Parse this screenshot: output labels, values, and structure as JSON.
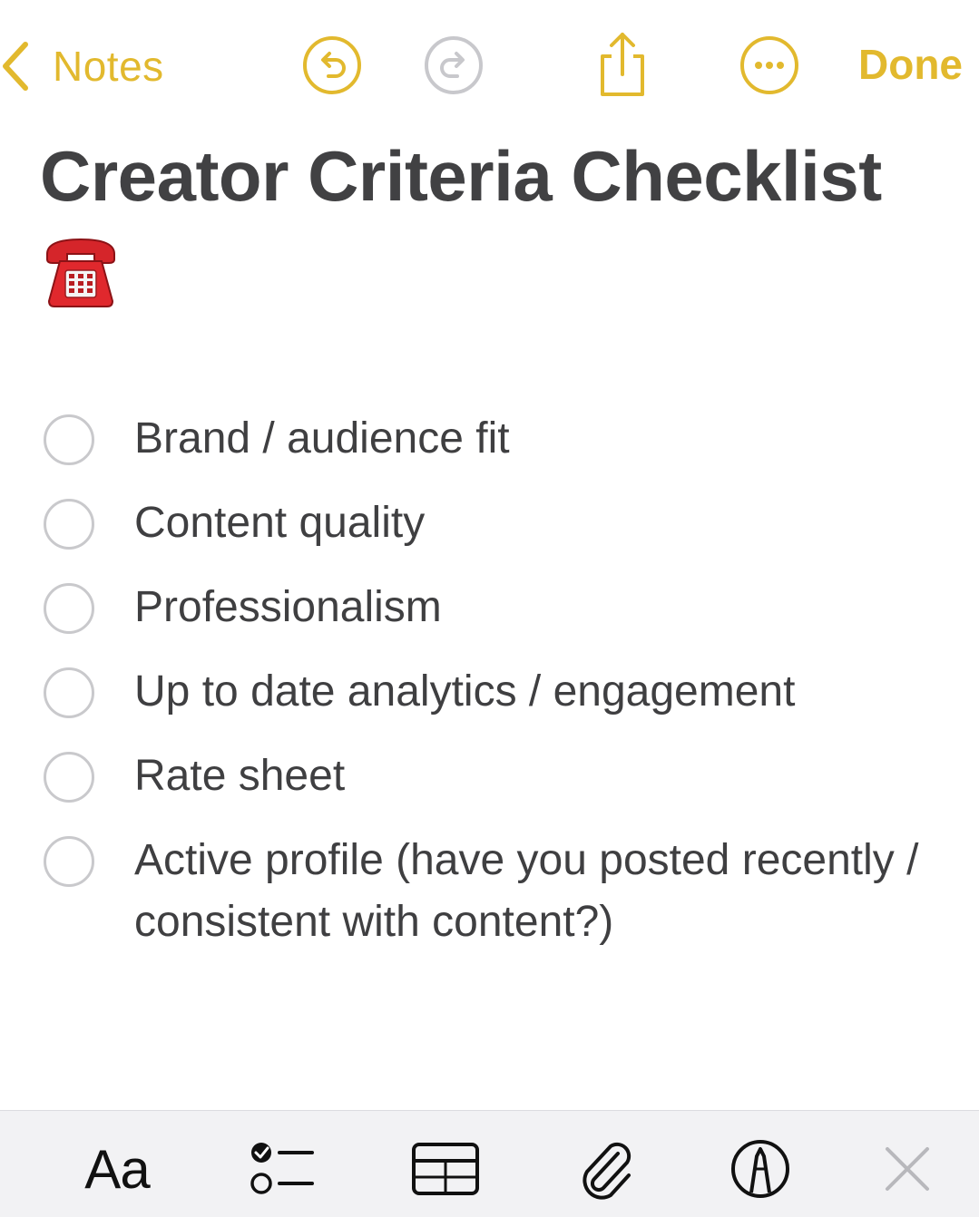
{
  "nav": {
    "back_label": "Notes",
    "done_label": "Done",
    "accent_color": "#e2b92e",
    "icons": [
      "chevron-left-icon",
      "undo-icon",
      "redo-icon",
      "share-icon",
      "more-icon"
    ]
  },
  "note": {
    "title": "Creator Criteria Checklist",
    "emoji": "telephone-emoji",
    "checklist": [
      {
        "text": "Brand / audience fit",
        "checked": false
      },
      {
        "text": "Content quality",
        "checked": false
      },
      {
        "text": "Professionalism",
        "checked": false
      },
      {
        "text": "Up to date analytics / engagement",
        "checked": false
      },
      {
        "text": "Rate sheet",
        "checked": false
      },
      {
        "text": "Active profile (have you posted recently / consistent with content?)",
        "checked": false
      }
    ]
  },
  "toolbar": {
    "format_label": "Aa",
    "icons": [
      "text-format-icon",
      "checklist-icon",
      "table-icon",
      "attachment-icon",
      "markup-icon",
      "close-icon"
    ]
  }
}
